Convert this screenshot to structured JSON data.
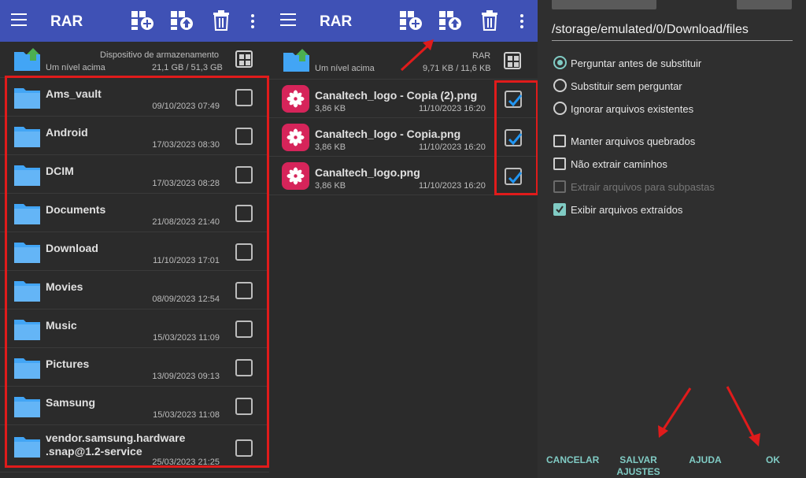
{
  "left_panel": {
    "title": "RAR",
    "storage": {
      "label": "Dispositivo de armazenamento",
      "up_label": "Um nível acima",
      "size": "21,1 GB / 51,3 GB"
    },
    "folders": [
      {
        "name": "Ams_vault",
        "date": "09/10/2023 07:49"
      },
      {
        "name": "Android",
        "date": "17/03/2023 08:30"
      },
      {
        "name": "DCIM",
        "date": "17/03/2023 08:28"
      },
      {
        "name": "Documents",
        "date": "21/08/2023 21:40"
      },
      {
        "name": "Download",
        "date": "11/10/2023 17:01"
      },
      {
        "name": "Movies",
        "date": "08/09/2023 12:54"
      },
      {
        "name": "Music",
        "date": "15/03/2023 11:09"
      },
      {
        "name": "Pictures",
        "date": "13/09/2023 09:13"
      },
      {
        "name": "Samsung",
        "date": "15/03/2023 11:08"
      },
      {
        "name_line1": "vendor.samsung.hardware",
        "name_line2": ".snap@1.2-service",
        "date": "25/03/2023 21:25"
      }
    ]
  },
  "middle_panel": {
    "title": "RAR",
    "header": {
      "label": "RAR",
      "up_label": "Um nível acima",
      "size": "9,71 KB / 11,6 KB"
    },
    "files": [
      {
        "name": "Canaltech_logo - Copia (2).png",
        "size": "3,86 KB",
        "date": "11/10/2023 16:20"
      },
      {
        "name": "Canaltech_logo - Copia.png",
        "size": "3,86 KB",
        "date": "11/10/2023 16:20"
      },
      {
        "name": "Canaltech_logo.png",
        "size": "3,86 KB",
        "date": "11/10/2023 16:20"
      }
    ]
  },
  "dialog": {
    "path": "/storage/emulated/0/Download/files",
    "radios": [
      {
        "label": "Perguntar antes de substituir",
        "selected": true
      },
      {
        "label": "Substituir sem perguntar",
        "selected": false
      },
      {
        "label": "Ignorar arquivos existentes",
        "selected": false
      }
    ],
    "checks": [
      {
        "label": "Manter arquivos quebrados",
        "checked": false,
        "disabled": false
      },
      {
        "label": "Não extrair caminhos",
        "checked": false,
        "disabled": false
      },
      {
        "label": "Extrair arquivos para subpastas",
        "checked": false,
        "disabled": true
      },
      {
        "label": "Exibir arquivos extraídos",
        "checked": true,
        "disabled": false
      }
    ],
    "buttons": {
      "cancel": "CANCELAR",
      "save_line1": "SALVAR",
      "save_line2": "AJUSTES",
      "help": "AJUDA",
      "ok": "OK"
    }
  },
  "colors": {
    "appbar": "#3f51b5",
    "highlight": "#e01b1b",
    "accent": "#80cbc4",
    "folder": "#42a5f5",
    "app_icon": "#d6245a",
    "check": "#2196f3"
  }
}
